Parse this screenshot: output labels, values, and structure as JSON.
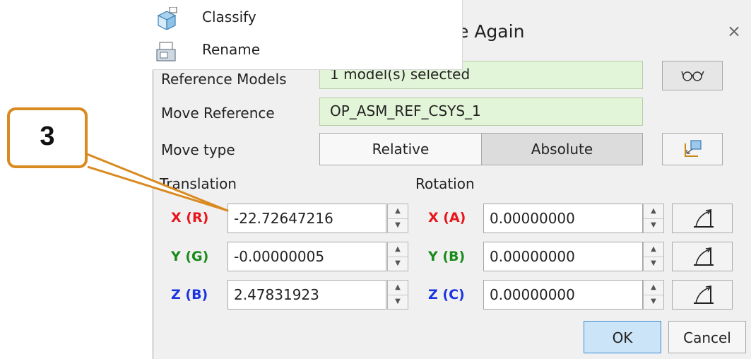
{
  "dialog": {
    "title_partial": "e Again",
    "close_glyph": "×"
  },
  "menu": {
    "items": [
      {
        "label": "Classify",
        "icon": "classify-icon"
      },
      {
        "label": "Rename",
        "icon": "rename-icon"
      }
    ]
  },
  "reference_models": {
    "label": "Reference Models",
    "value": "1 model(s) selected",
    "button_icon": "glasses-icon"
  },
  "move_reference": {
    "label": "Move Reference",
    "value": "OP_ASM_REF_CSYS_1"
  },
  "move_type": {
    "label": "Move type",
    "options": [
      "Relative",
      "Absolute"
    ],
    "selected": "Absolute",
    "button_icon": "move-frame-icon"
  },
  "translation": {
    "label": "Translation",
    "rows": [
      {
        "axis": "X (R)",
        "value": "-22.72647216",
        "color": "#e8141a"
      },
      {
        "axis": "Y (G)",
        "value": "-0.00000005",
        "color": "#1a8a1a"
      },
      {
        "axis": "Z (B)",
        "value": "2.47831923",
        "color": "#1a33e0"
      }
    ]
  },
  "rotation": {
    "label": "Rotation",
    "rows": [
      {
        "axis": "X (A)",
        "value": "0.00000000",
        "color": "#e8141a"
      },
      {
        "axis": "Y (B)",
        "value": "0.00000000",
        "color": "#1a8a1a"
      },
      {
        "axis": "Z (C)",
        "value": "0.00000000",
        "color": "#1a33e0"
      }
    ]
  },
  "footer": {
    "ok_label": "OK",
    "cancel_label": "Cancel"
  },
  "callout": {
    "number": "3",
    "color": "#d98a20"
  }
}
